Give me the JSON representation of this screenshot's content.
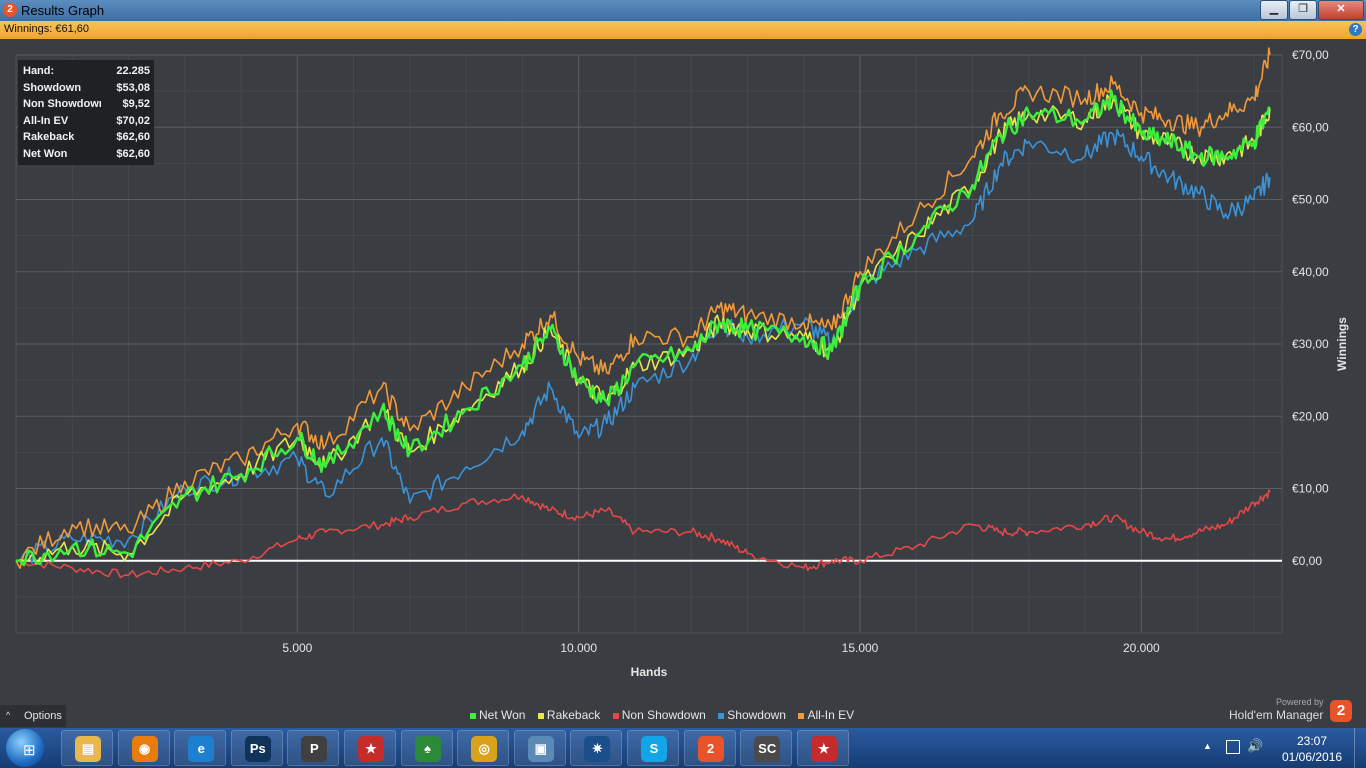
{
  "window": {
    "title": "Results Graph",
    "logo_glyph": "2",
    "minimize_glyph": "▁",
    "maximize_glyph": "❐",
    "close_glyph": "✕"
  },
  "winnings_bar": {
    "label": "Winnings: €61,60",
    "help_glyph": "?"
  },
  "stats": [
    {
      "label": "Hand:",
      "value": "22.285"
    },
    {
      "label": "Showdown",
      "value": "$53,08"
    },
    {
      "label": "Non Showdown",
      "value": "$9,52"
    },
    {
      "label": "All-In EV",
      "value": "$70,02"
    },
    {
      "label": "Rakeback",
      "value": "$62,60"
    },
    {
      "label": "Net Won",
      "value": "$62,60"
    }
  ],
  "options": {
    "label": "Options",
    "chevron": "^"
  },
  "branding": {
    "powered_by": "Powered by",
    "name": "Hold'em Manager",
    "logo_glyph": "2"
  },
  "colors": {
    "background": "#3a3d42",
    "grid": "#4d5157",
    "zero_line": "#ffffff",
    "net_won": "#3dee3d",
    "rakeback": "#e8e84a",
    "non_showdown": "#e54848",
    "showdown": "#3a93d8",
    "all_in_ev": "#f29a3a"
  },
  "chart_data": {
    "type": "line",
    "xlabel": "Hands",
    "ylabel": "Winnings",
    "xlim": [
      0,
      22500
    ],
    "ylim": [
      -10,
      70
    ],
    "x_ticks": [
      5000,
      10000,
      15000,
      20000
    ],
    "x_tick_labels": [
      "5.000",
      "10.000",
      "15.000",
      "20.000"
    ],
    "y_ticks": [
      0,
      10,
      20,
      30,
      40,
      50,
      60,
      70
    ],
    "y_tick_labels": [
      "€0,00",
      "€10,00",
      "€20,00",
      "€30,00",
      "€40,00",
      "€50,00",
      "€60,00",
      "€70,00"
    ],
    "grid": true,
    "legend_position": "bottom",
    "x": [
      0,
      1000,
      2000,
      3000,
      4000,
      5000,
      5500,
      6500,
      7000,
      8000,
      9000,
      9500,
      10000,
      10500,
      11000,
      12000,
      12500,
      13000,
      14000,
      14500,
      15000,
      16000,
      17000,
      17500,
      18000,
      19000,
      19500,
      20000,
      20500,
      21000,
      21500,
      22000,
      22285
    ],
    "series": [
      {
        "name": "Net Won",
        "color_key": "net_won",
        "values": [
          0,
          2,
          1,
          9,
          12,
          17,
          13,
          21,
          15,
          21,
          27,
          32,
          25,
          22,
          27,
          29,
          33,
          32,
          31,
          29,
          38,
          45,
          52,
          59,
          62,
          61,
          64,
          59,
          58,
          56,
          56,
          58,
          62.6
        ]
      },
      {
        "name": "Rakeback",
        "color_key": "rakeback",
        "values": [
          0,
          2,
          1,
          9,
          12,
          17,
          13,
          21,
          15,
          21,
          27,
          32,
          25,
          22,
          27,
          29,
          33,
          32,
          31,
          29,
          38,
          45,
          52,
          59,
          62,
          61,
          64,
          59,
          58,
          56,
          56,
          58,
          62.6
        ]
      },
      {
        "name": "Non Showdown",
        "color_key": "non_showdown",
        "values": [
          0,
          -1,
          -2,
          -1,
          0,
          3,
          4,
          5,
          6,
          8,
          9,
          7,
          6,
          7,
          4,
          4,
          3,
          1,
          -1,
          0,
          0,
          2,
          5,
          4,
          4,
          5,
          6,
          4,
          3,
          4,
          5,
          8,
          9.52
        ]
      },
      {
        "name": "Showdown",
        "color_key": "showdown",
        "values": [
          0,
          3,
          3,
          10,
          12,
          14,
          9,
          17,
          8,
          13,
          18,
          24,
          17,
          19,
          24,
          28,
          33,
          31,
          33,
          30,
          38,
          43,
          47,
          55,
          58,
          56,
          59,
          56,
          53,
          51,
          48,
          50,
          53.08
        ]
      },
      {
        "name": "All-In EV",
        "color_key": "all_in_ev",
        "values": [
          0,
          5,
          4,
          11,
          14,
          19,
          16,
          24,
          18,
          24,
          30,
          34,
          28,
          26,
          31,
          31,
          35,
          34,
          33,
          32,
          40,
          48,
          56,
          62,
          65,
          64,
          66,
          62,
          61,
          60,
          62,
          64,
          70.02
        ]
      }
    ]
  },
  "taskbar": {
    "start_glyph": "⊞",
    "apps": [
      {
        "name": "file-explorer-icon",
        "glyph": "▤",
        "color": "#e8b84a"
      },
      {
        "name": "blender-icon",
        "glyph": "◉",
        "color": "#e87d0d"
      },
      {
        "name": "internet-explorer-icon",
        "glyph": "e",
        "color": "#1e7fd0"
      },
      {
        "name": "photoshop-icon",
        "glyph": "Ps",
        "color": "#10335a"
      },
      {
        "name": "pokerx-icon",
        "glyph": "P",
        "color": "#404040"
      },
      {
        "name": "pokerstars-icon",
        "glyph": "★",
        "color": "#c62b2b"
      },
      {
        "name": "poker-table-icon",
        "glyph": "♠",
        "color": "#2a8a3a"
      },
      {
        "name": "chrome-icon",
        "glyph": "◎",
        "color": "#d9a21b"
      },
      {
        "name": "photo-viewer-icon",
        "glyph": "▣",
        "color": "#5a8ab5"
      },
      {
        "name": "battlenet-icon",
        "glyph": "✷",
        "color": "#1b4f8a"
      },
      {
        "name": "skype-icon",
        "glyph": "S",
        "color": "#12a5e8"
      },
      {
        "name": "holdem-manager-icon",
        "glyph": "2",
        "color": "#e8532a"
      },
      {
        "name": "starcraft-icon",
        "glyph": "SC",
        "color": "#4a4a4a"
      },
      {
        "name": "pokerstars-2-icon",
        "glyph": "★",
        "color": "#c62b2b"
      }
    ],
    "tray_arrow": "▲",
    "volume_glyph": "🔊",
    "clock_time": "23:07",
    "clock_date": "01/06/2016"
  }
}
